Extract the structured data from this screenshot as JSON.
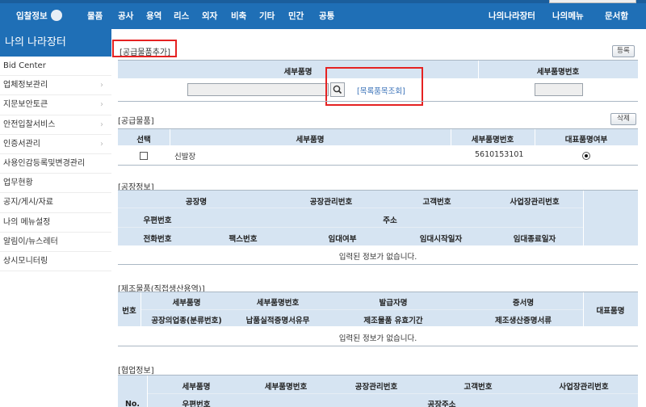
{
  "topnav": {
    "home": "입찰정보",
    "items": [
      "물품",
      "공사",
      "용역",
      "리스",
      "외자",
      "비축",
      "기타",
      "민간",
      "공통"
    ],
    "right_items": [
      "나의나라장터",
      "나의메뉴",
      "문서함"
    ]
  },
  "sidebar": {
    "title": "나의 나라장터",
    "items": [
      {
        "label": "Bid Center",
        "has_submenu": false
      },
      {
        "label": "업체정보관리",
        "has_submenu": true
      },
      {
        "label": "지문보안토큰",
        "has_submenu": true
      },
      {
        "label": "안전입찰서비스",
        "has_submenu": true
      },
      {
        "label": "인증서관리",
        "has_submenu": true
      },
      {
        "label": "사용인감등록및변경관리",
        "has_submenu": false
      },
      {
        "label": "업무현황",
        "has_submenu": false
      },
      {
        "label": "공지/게시/자료",
        "has_submenu": false
      },
      {
        "label": "나의 메뉴설정",
        "has_submenu": false
      },
      {
        "label": "알림이/뉴스레터",
        "has_submenu": false
      },
      {
        "label": "상시모니터링",
        "has_submenu": false
      }
    ]
  },
  "add_supply": {
    "title": "[공급물품추가]",
    "register_button": "등록",
    "col_item_name": "세부품명",
    "col_item_number": "세부품명번호",
    "item_name_value": "",
    "item_number_value": "",
    "catalog_link": "[목록품목조회]"
  },
  "supply_items": {
    "title": "[공급물품]",
    "delete_button": "삭제",
    "columns": [
      "선택",
      "세부품명",
      "세부품명번호",
      "대표품명여부"
    ],
    "rows": [
      {
        "item_name": "신발장",
        "item_number": "5610153101",
        "selected": false,
        "representative": true
      }
    ]
  },
  "factory_info": {
    "title": "[공장정보]",
    "row1": [
      "공장명",
      "공장관리번호",
      "고객번호",
      "사업장관리번호"
    ],
    "row2": [
      "우편번호",
      "주소"
    ],
    "row3": [
      "전화번호",
      "팩스번호",
      "임대여부",
      "임대시작일자",
      "임대종료일자"
    ],
    "empty_message": "입력된 정보가 없습니다."
  },
  "manufactured_items": {
    "title": "[제조물품(직접생산용역)]",
    "col_no": "번호",
    "row1": [
      "세부품명",
      "세부품명번호",
      "발급자명",
      "증서명"
    ],
    "row2": [
      "공장의업종(분류번호)",
      "납품실적증명서유무",
      "제조물품 유효기간",
      "제조생산증명서류"
    ],
    "col_rep": "대표품명",
    "empty_message": "입력된 정보가 없습니다."
  },
  "cooperation_info": {
    "title": "[협업정보]",
    "col_no": "No.",
    "row1": [
      "세부품명",
      "세부품명번호",
      "공장관리번호",
      "고객번호",
      "사업장관리번호"
    ],
    "row2": [
      "우편번호",
      "공장주소"
    ]
  }
}
